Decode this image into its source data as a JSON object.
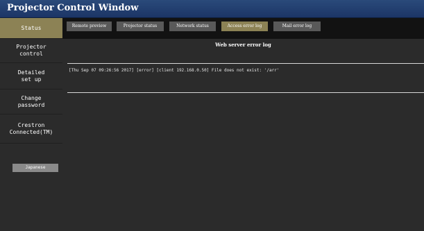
{
  "window": {
    "title": "Projector Control Window"
  },
  "sidebar": {
    "items": [
      {
        "label": "Status",
        "active": true
      },
      {
        "label": "Projector\ncontrol",
        "active": false
      },
      {
        "label": "Detailed\nset up",
        "active": false
      },
      {
        "label": "Change\npassword",
        "active": false
      },
      {
        "label": "Crestron\nConnected(TM)",
        "active": false
      }
    ],
    "language_button": "Japanese"
  },
  "tabs": [
    {
      "label": "Remote preview",
      "active": false
    },
    {
      "label": "Projector status",
      "active": false
    },
    {
      "label": "Network status",
      "active": false
    },
    {
      "label": "Access error log",
      "active": true
    },
    {
      "label": "Mail error log",
      "active": false
    }
  ],
  "panel": {
    "title": "Web server error log",
    "log_lines": [
      "[Thu Sep 07 09:26:56 2017] [error] [client 192.168.0.50] File does not exist: '/arr'"
    ]
  },
  "colors": {
    "titlebar": "#1c3566",
    "active_accent": "#8c8255",
    "background": "#2b2b2b",
    "tabbar": "#121212"
  }
}
